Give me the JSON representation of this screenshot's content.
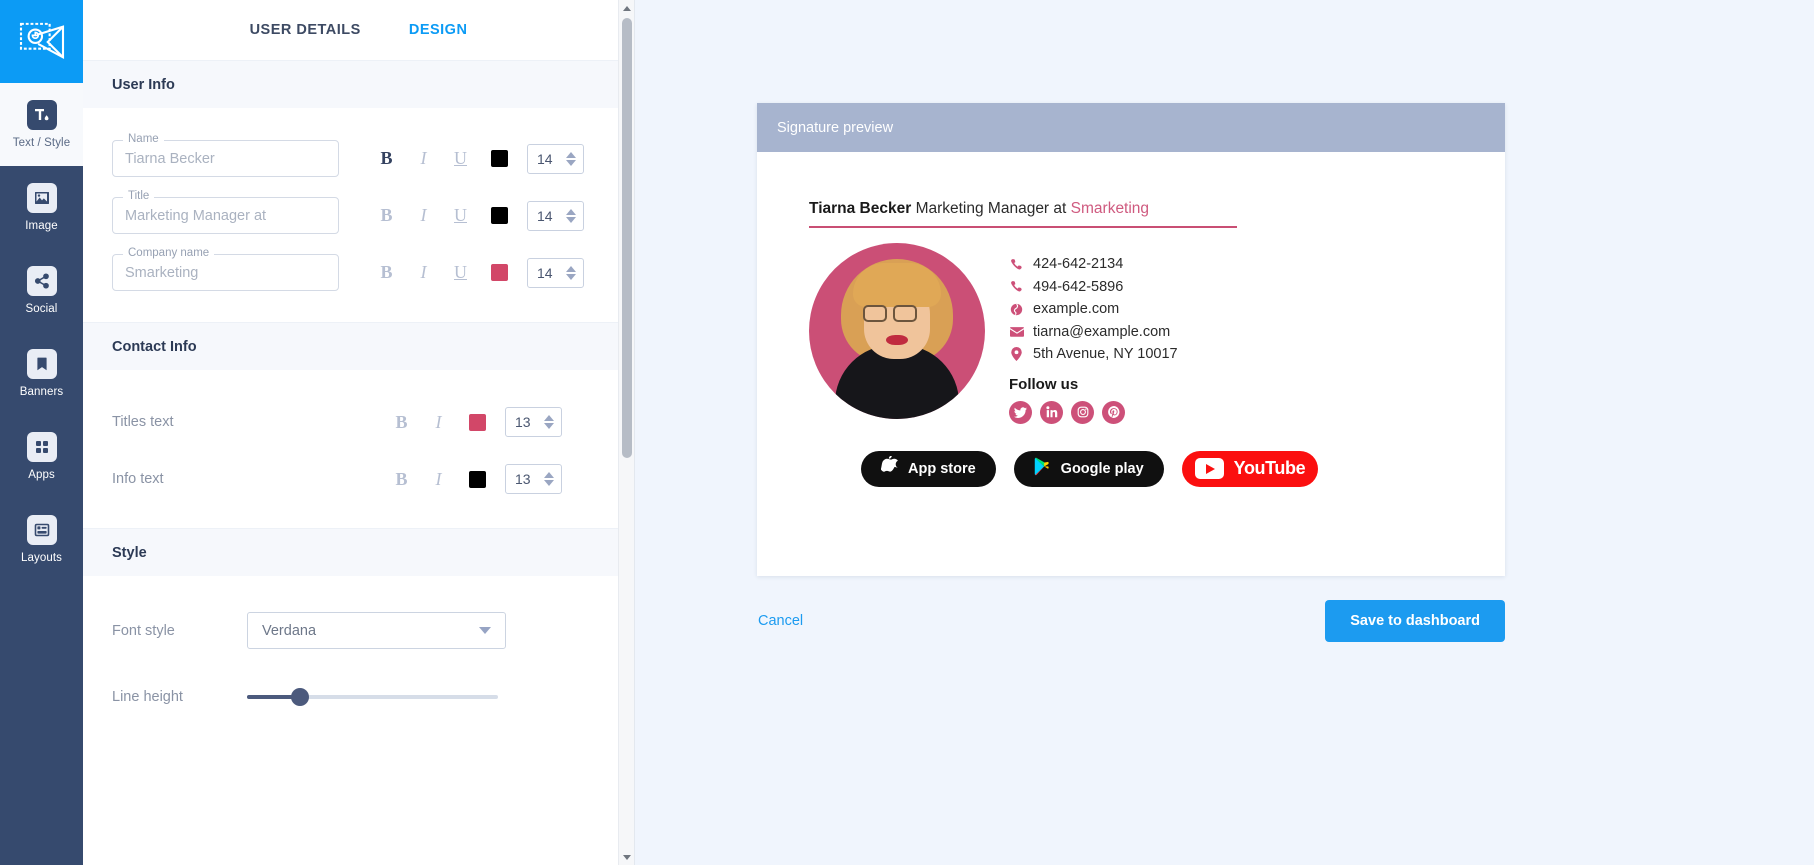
{
  "rail": {
    "logo_icon": "envelope-at-logo",
    "items": [
      {
        "label": "Text / Style",
        "icon": "text-style-icon",
        "active": true
      },
      {
        "label": "Image",
        "icon": "image-icon",
        "active": false
      },
      {
        "label": "Social",
        "icon": "share-icon",
        "active": false
      },
      {
        "label": "Banners",
        "icon": "bookmark-icon",
        "active": false
      },
      {
        "label": "Apps",
        "icon": "grid-apps-icon",
        "active": false
      },
      {
        "label": "Layouts",
        "icon": "layouts-icon",
        "active": false
      }
    ]
  },
  "panel": {
    "tabs": [
      {
        "label": "USER DETAILS",
        "active": true
      },
      {
        "label": "DESIGN",
        "active": false
      }
    ],
    "sections": {
      "user_info": {
        "title": "User Info",
        "fields": [
          {
            "legend": "Name",
            "value": "Tiarna Becker",
            "bold": true,
            "italic": false,
            "underline": false,
            "color": "#000000",
            "size": "14"
          },
          {
            "legend": "Title",
            "value": "Marketing Manager at",
            "bold": false,
            "italic": false,
            "underline": false,
            "color": "#000000",
            "size": "14"
          },
          {
            "legend": "Company name",
            "value": "Smarketing",
            "bold": false,
            "italic": false,
            "underline": false,
            "color": "#d24768",
            "size": "14"
          }
        ],
        "bold_label": "B",
        "italic_label": "I",
        "underline_label": "U"
      },
      "contact_info": {
        "title": "Contact Info",
        "rows": [
          {
            "label": "Titles text",
            "color": "#d24768",
            "size": "13"
          },
          {
            "label": "Info text",
            "color": "#000000",
            "size": "13"
          }
        ]
      },
      "style": {
        "title": "Style",
        "font_style_label": "Font style",
        "font_style_value": "Verdana",
        "line_height_label": "Line height",
        "line_height_percent": 21
      }
    }
  },
  "preview": {
    "bar_title": "Signature preview",
    "signature": {
      "name": "Tiarna Becker",
      "title": "Marketing Manager at",
      "company": "Smarketing",
      "company_color": "#cf5a7f",
      "rule_color": "#c94f74",
      "contacts": [
        {
          "icon": "phone-icon",
          "text": "424-642-2134"
        },
        {
          "icon": "phone-icon",
          "text": "494-642-5896"
        },
        {
          "icon": "globe-icon",
          "text": "example.com"
        },
        {
          "icon": "envelope-icon",
          "text": "tiarna@example.com"
        },
        {
          "icon": "map-pin-icon",
          "text": "5th Avenue, NY 10017"
        }
      ],
      "follow_label": "Follow us",
      "socials": [
        {
          "icon": "twitter-icon"
        },
        {
          "icon": "linkedin-icon"
        },
        {
          "icon": "instagram-icon"
        },
        {
          "icon": "pinterest-icon"
        }
      ],
      "badges": [
        {
          "label": "App store",
          "icon": "apple-icon",
          "style": "dark"
        },
        {
          "label": "Google play",
          "icon": "google-play-icon",
          "style": "dark"
        },
        {
          "label": "YouTube",
          "icon": "youtube-icon",
          "style": "red"
        }
      ]
    }
  },
  "footer": {
    "cancel_label": "Cancel",
    "save_label": "Save to dashboard"
  }
}
